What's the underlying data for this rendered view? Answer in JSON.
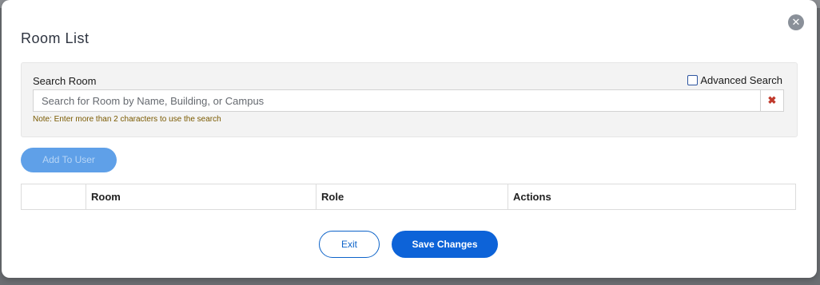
{
  "modal": {
    "title": "Room List",
    "close_icon": "close-icon"
  },
  "search": {
    "label": "Search Room",
    "advanced_label": "Advanced Search",
    "advanced_checked": false,
    "placeholder": "Search for Room by Name, Building, or Campus",
    "value": "",
    "clear_glyph": "✖",
    "note": "Note: Enter more than 2 characters to use the search"
  },
  "actions": {
    "add_to_user": "Add To User"
  },
  "table": {
    "columns": [
      "",
      "Room",
      "Role",
      "Actions"
    ]
  },
  "footer": {
    "exit_label": "Exit",
    "save_label": "Save Changes"
  },
  "colors": {
    "primary": "#0d63d8",
    "disabled_button": "#5fa0e8",
    "note_text": "#7a5a00",
    "clear_icon": "#c0392b"
  }
}
